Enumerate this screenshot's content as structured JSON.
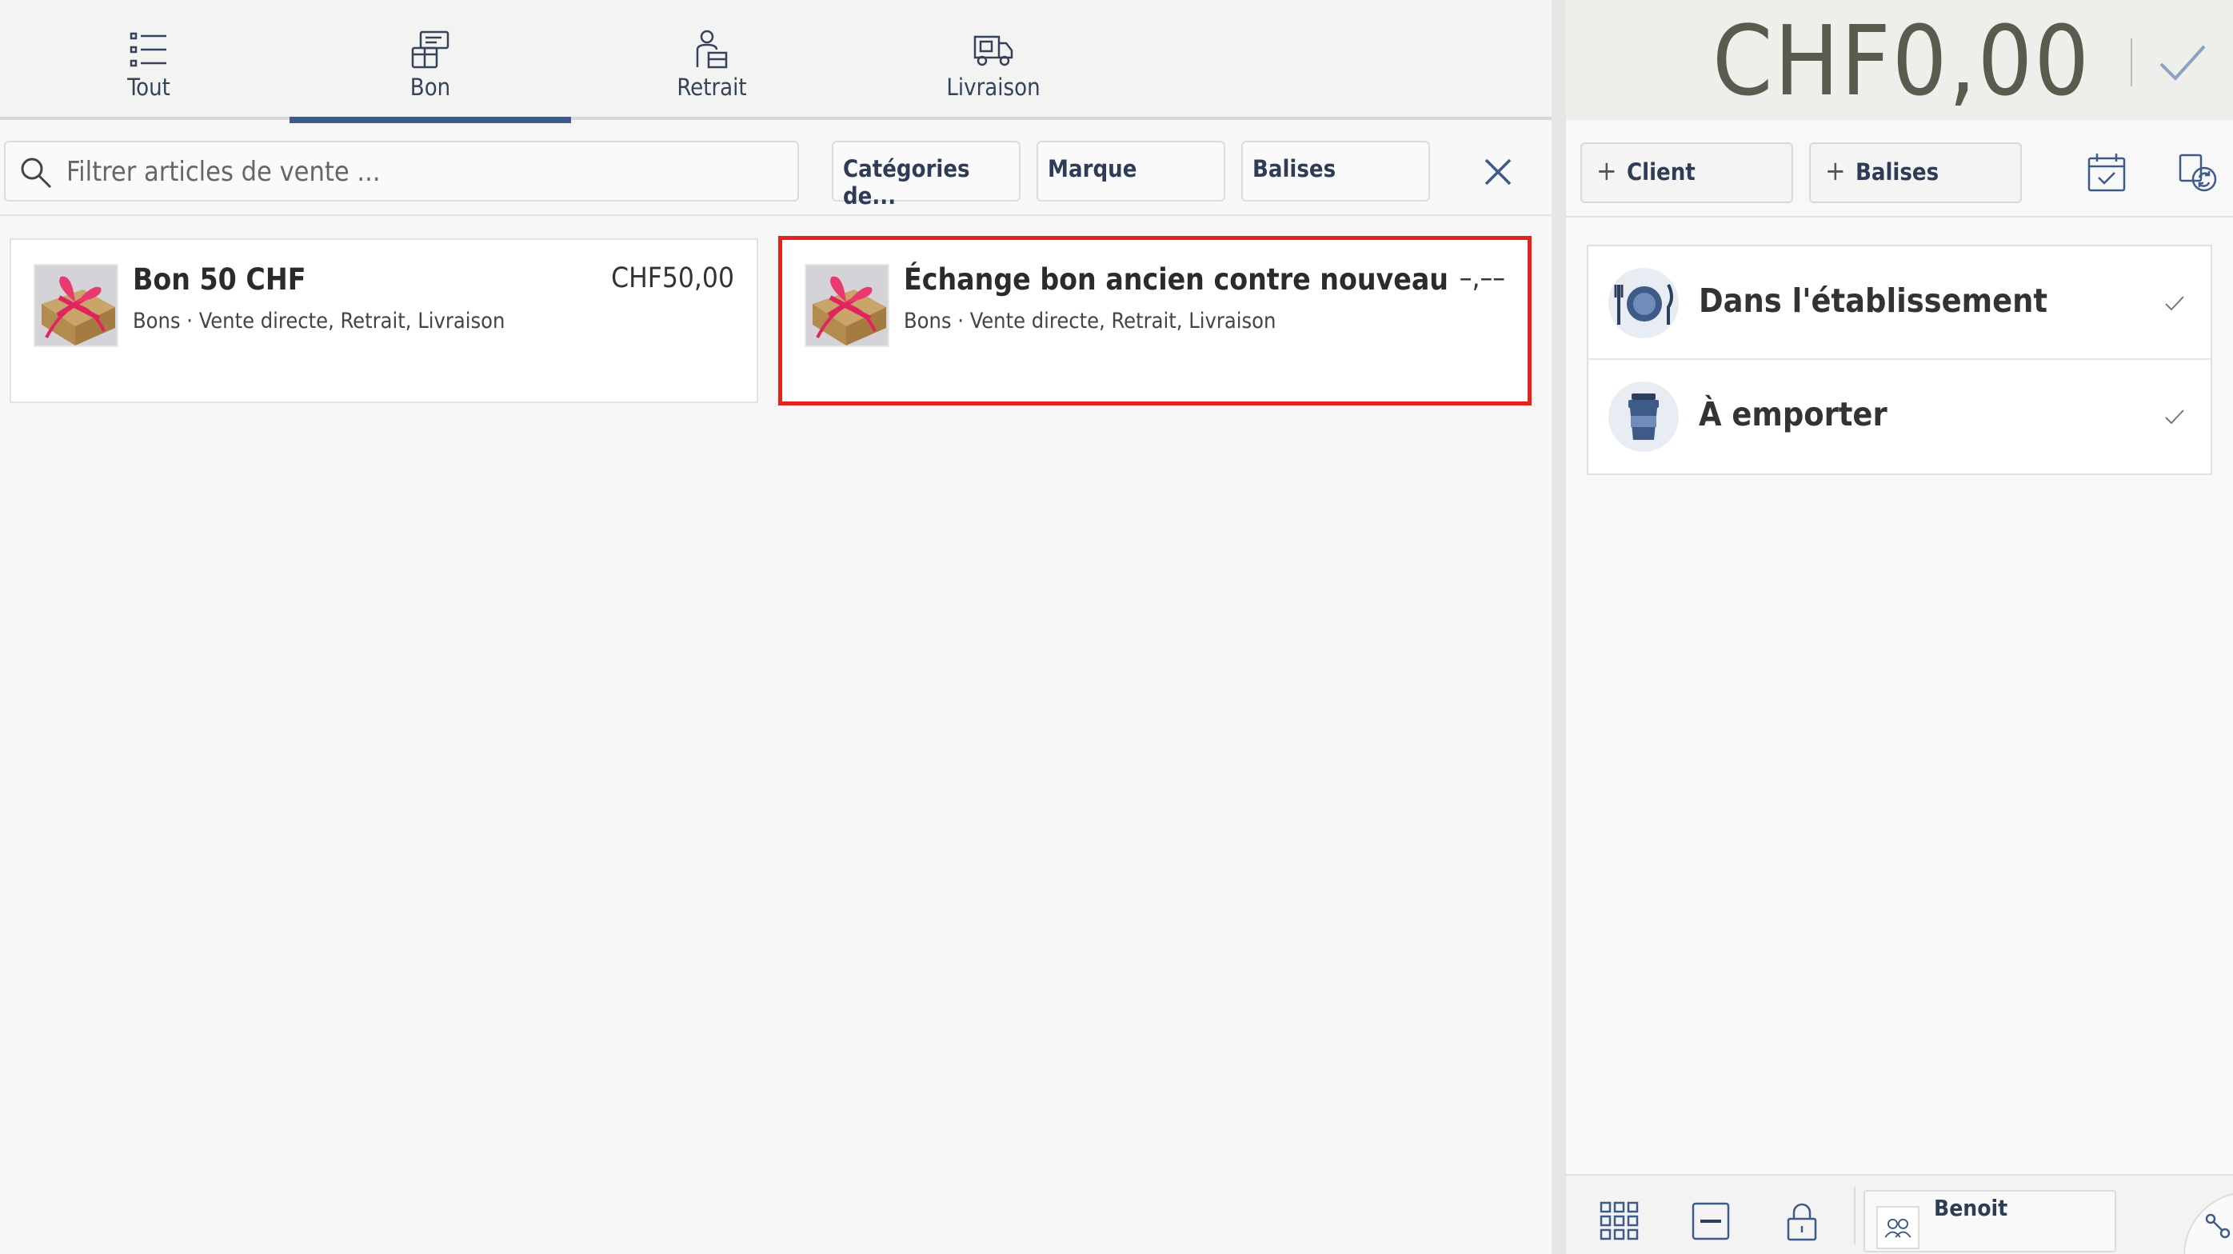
{
  "tabs": [
    {
      "label": "Tout",
      "icon": "list-icon"
    },
    {
      "label": "Bon",
      "icon": "voucher-icon",
      "active": true
    },
    {
      "label": "Retrait",
      "icon": "pickup-icon"
    },
    {
      "label": "Livraison",
      "icon": "delivery-truck-icon"
    }
  ],
  "filters": {
    "search_placeholder": "Filtrer articles de vente ...",
    "category_label": "Catégories de...",
    "brand_label": "Marque",
    "tags_label": "Balises"
  },
  "products": [
    {
      "name": "Bon 50 CHF",
      "meta": "Bons · Vente directe, Retrait, Livraison",
      "price": "CHF50,00"
    },
    {
      "name": "Échange bon ancien contre nouveau",
      "meta": "Bons · Vente directe, Retrait, Livraison",
      "price": "–,––"
    }
  ],
  "cart": {
    "total": "CHF0,00",
    "client_label": "Client",
    "tags_label": "Balises"
  },
  "order_types": [
    {
      "label": "Dans l'établissement",
      "icon": "plate-cutlery-icon"
    },
    {
      "label": "À emporter",
      "icon": "takeaway-cup-icon"
    }
  ],
  "footer": {
    "user_name": "Benoit"
  },
  "colors": {
    "accent": "#3e5a86",
    "highlight": "#e3221c"
  }
}
